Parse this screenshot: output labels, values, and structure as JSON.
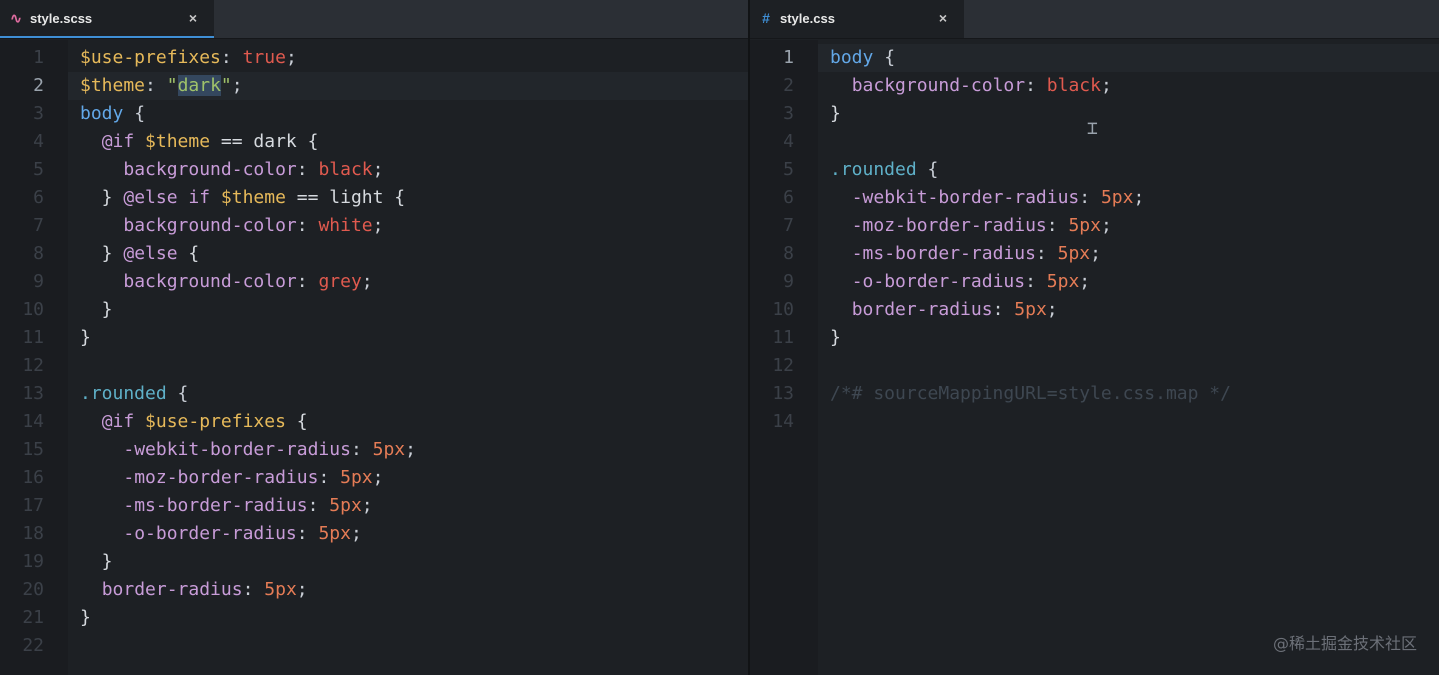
{
  "left_pane": {
    "tab": {
      "title": "style.scss",
      "icon": "sass-file-icon",
      "icon_glyph": "∿",
      "icon_color": "#e06ca1",
      "close_glyph": "×"
    },
    "active_line": 2,
    "lines": [
      {
        "n": "1",
        "tokens": [
          {
            "c": "t-var",
            "t": "$use-prefixes"
          },
          {
            "c": "t-punc",
            "t": ": "
          },
          {
            "c": "t-val",
            "t": "true"
          },
          {
            "c": "t-punc",
            "t": ";"
          }
        ]
      },
      {
        "n": "2",
        "tokens": [
          {
            "c": "t-var",
            "t": "$theme"
          },
          {
            "c": "t-punc",
            "t": ": "
          },
          {
            "c": "t-str",
            "t": "\""
          },
          {
            "c": "t-str t-sel",
            "t": "dark"
          },
          {
            "c": "t-str",
            "t": "\""
          },
          {
            "c": "t-punc",
            "t": ";"
          }
        ]
      },
      {
        "n": "3",
        "tokens": [
          {
            "c": "t-tag",
            "t": "body"
          },
          {
            "c": "t-punc",
            "t": " {"
          }
        ]
      },
      {
        "n": "4",
        "tokens": [
          {
            "c": "t-plain",
            "t": "  "
          },
          {
            "c": "t-kw",
            "t": "@if"
          },
          {
            "c": "t-plain",
            "t": " "
          },
          {
            "c": "t-var",
            "t": "$theme"
          },
          {
            "c": "t-plain",
            "t": " == dark {"
          }
        ]
      },
      {
        "n": "5",
        "tokens": [
          {
            "c": "t-plain",
            "t": "    "
          },
          {
            "c": "t-prop",
            "t": "background-color"
          },
          {
            "c": "t-punc",
            "t": ": "
          },
          {
            "c": "t-val",
            "t": "black"
          },
          {
            "c": "t-punc",
            "t": ";"
          }
        ]
      },
      {
        "n": "6",
        "tokens": [
          {
            "c": "t-plain",
            "t": "  } "
          },
          {
            "c": "t-kw",
            "t": "@else if"
          },
          {
            "c": "t-plain",
            "t": " "
          },
          {
            "c": "t-var",
            "t": "$theme"
          },
          {
            "c": "t-plain",
            "t": " == light {"
          }
        ]
      },
      {
        "n": "7",
        "tokens": [
          {
            "c": "t-plain",
            "t": "    "
          },
          {
            "c": "t-prop",
            "t": "background-color"
          },
          {
            "c": "t-punc",
            "t": ": "
          },
          {
            "c": "t-val",
            "t": "white"
          },
          {
            "c": "t-punc",
            "t": ";"
          }
        ]
      },
      {
        "n": "8",
        "tokens": [
          {
            "c": "t-plain",
            "t": "  } "
          },
          {
            "c": "t-kw",
            "t": "@else"
          },
          {
            "c": "t-plain",
            "t": " {"
          }
        ]
      },
      {
        "n": "9",
        "tokens": [
          {
            "c": "t-plain",
            "t": "    "
          },
          {
            "c": "t-prop",
            "t": "background-color"
          },
          {
            "c": "t-punc",
            "t": ": "
          },
          {
            "c": "t-val",
            "t": "grey"
          },
          {
            "c": "t-punc",
            "t": ";"
          }
        ]
      },
      {
        "n": "10",
        "tokens": [
          {
            "c": "t-plain",
            "t": "  }"
          }
        ]
      },
      {
        "n": "11",
        "tokens": [
          {
            "c": "t-plain",
            "t": "}"
          }
        ]
      },
      {
        "n": "12",
        "tokens": []
      },
      {
        "n": "13",
        "tokens": [
          {
            "c": "t-cls",
            "t": ".rounded"
          },
          {
            "c": "t-punc",
            "t": " {"
          }
        ]
      },
      {
        "n": "14",
        "tokens": [
          {
            "c": "t-plain",
            "t": "  "
          },
          {
            "c": "t-kw",
            "t": "@if"
          },
          {
            "c": "t-plain",
            "t": " "
          },
          {
            "c": "t-var",
            "t": "$use-prefixes"
          },
          {
            "c": "t-plain",
            "t": " {"
          }
        ]
      },
      {
        "n": "15",
        "tokens": [
          {
            "c": "t-plain",
            "t": "    "
          },
          {
            "c": "t-prop",
            "t": "-webkit-border-radius"
          },
          {
            "c": "t-punc",
            "t": ": "
          },
          {
            "c": "t-num",
            "t": "5px"
          },
          {
            "c": "t-punc",
            "t": ";"
          }
        ]
      },
      {
        "n": "16",
        "tokens": [
          {
            "c": "t-plain",
            "t": "    "
          },
          {
            "c": "t-prop",
            "t": "-moz-border-radius"
          },
          {
            "c": "t-punc",
            "t": ": "
          },
          {
            "c": "t-num",
            "t": "5px"
          },
          {
            "c": "t-punc",
            "t": ";"
          }
        ]
      },
      {
        "n": "17",
        "tokens": [
          {
            "c": "t-plain",
            "t": "    "
          },
          {
            "c": "t-prop",
            "t": "-ms-border-radius"
          },
          {
            "c": "t-punc",
            "t": ": "
          },
          {
            "c": "t-num",
            "t": "5px"
          },
          {
            "c": "t-punc",
            "t": ";"
          }
        ]
      },
      {
        "n": "18",
        "tokens": [
          {
            "c": "t-plain",
            "t": "    "
          },
          {
            "c": "t-prop",
            "t": "-o-border-radius"
          },
          {
            "c": "t-punc",
            "t": ": "
          },
          {
            "c": "t-num",
            "t": "5px"
          },
          {
            "c": "t-punc",
            "t": ";"
          }
        ]
      },
      {
        "n": "19",
        "tokens": [
          {
            "c": "t-plain",
            "t": "  }"
          }
        ]
      },
      {
        "n": "20",
        "tokens": [
          {
            "c": "t-plain",
            "t": "  "
          },
          {
            "c": "t-prop",
            "t": "border-radius"
          },
          {
            "c": "t-punc",
            "t": ": "
          },
          {
            "c": "t-num",
            "t": "5px"
          },
          {
            "c": "t-punc",
            "t": ";"
          }
        ]
      },
      {
        "n": "21",
        "tokens": [
          {
            "c": "t-plain",
            "t": "}"
          }
        ]
      },
      {
        "n": "22",
        "tokens": []
      }
    ]
  },
  "right_pane": {
    "tab": {
      "title": "style.css",
      "icon": "css-file-icon",
      "icon_glyph": "#",
      "icon_color": "#3f8fd6",
      "close_glyph": "×"
    },
    "active_line": 1,
    "lines": [
      {
        "n": "1",
        "tokens": [
          {
            "c": "t-tag",
            "t": "body"
          },
          {
            "c": "t-punc",
            "t": " {"
          }
        ]
      },
      {
        "n": "2",
        "tokens": [
          {
            "c": "t-plain",
            "t": "  "
          },
          {
            "c": "t-prop",
            "t": "background-color"
          },
          {
            "c": "t-punc",
            "t": ": "
          },
          {
            "c": "t-val",
            "t": "black"
          },
          {
            "c": "t-punc",
            "t": ";"
          }
        ]
      },
      {
        "n": "3",
        "tokens": [
          {
            "c": "t-plain",
            "t": "}"
          }
        ]
      },
      {
        "n": "4",
        "tokens": []
      },
      {
        "n": "5",
        "tokens": [
          {
            "c": "t-cls",
            "t": ".rounded"
          },
          {
            "c": "t-punc",
            "t": " {"
          }
        ]
      },
      {
        "n": "6",
        "tokens": [
          {
            "c": "t-plain",
            "t": "  "
          },
          {
            "c": "t-prop",
            "t": "-webkit-border-radius"
          },
          {
            "c": "t-punc",
            "t": ": "
          },
          {
            "c": "t-num",
            "t": "5px"
          },
          {
            "c": "t-punc",
            "t": ";"
          }
        ]
      },
      {
        "n": "7",
        "tokens": [
          {
            "c": "t-plain",
            "t": "  "
          },
          {
            "c": "t-prop",
            "t": "-moz-border-radius"
          },
          {
            "c": "t-punc",
            "t": ": "
          },
          {
            "c": "t-num",
            "t": "5px"
          },
          {
            "c": "t-punc",
            "t": ";"
          }
        ]
      },
      {
        "n": "8",
        "tokens": [
          {
            "c": "t-plain",
            "t": "  "
          },
          {
            "c": "t-prop",
            "t": "-ms-border-radius"
          },
          {
            "c": "t-punc",
            "t": ": "
          },
          {
            "c": "t-num",
            "t": "5px"
          },
          {
            "c": "t-punc",
            "t": ";"
          }
        ]
      },
      {
        "n": "9",
        "tokens": [
          {
            "c": "t-plain",
            "t": "  "
          },
          {
            "c": "t-prop",
            "t": "-o-border-radius"
          },
          {
            "c": "t-punc",
            "t": ": "
          },
          {
            "c": "t-num",
            "t": "5px"
          },
          {
            "c": "t-punc",
            "t": ";"
          }
        ]
      },
      {
        "n": "10",
        "tokens": [
          {
            "c": "t-plain",
            "t": "  "
          },
          {
            "c": "t-prop",
            "t": "border-radius"
          },
          {
            "c": "t-punc",
            "t": ": "
          },
          {
            "c": "t-num",
            "t": "5px"
          },
          {
            "c": "t-punc",
            "t": ";"
          }
        ]
      },
      {
        "n": "11",
        "tokens": [
          {
            "c": "t-plain",
            "t": "}"
          }
        ]
      },
      {
        "n": "12",
        "tokens": []
      },
      {
        "n": "13",
        "tokens": [
          {
            "c": "t-com",
            "t": "/*# sourceMappingURL=style.css.map */"
          }
        ]
      },
      {
        "n": "14",
        "tokens": []
      }
    ]
  },
  "cursor_icon": "text-cursor-icon",
  "cursor_glyph": "⌶",
  "watermark": "@稀土掘金技术社区"
}
